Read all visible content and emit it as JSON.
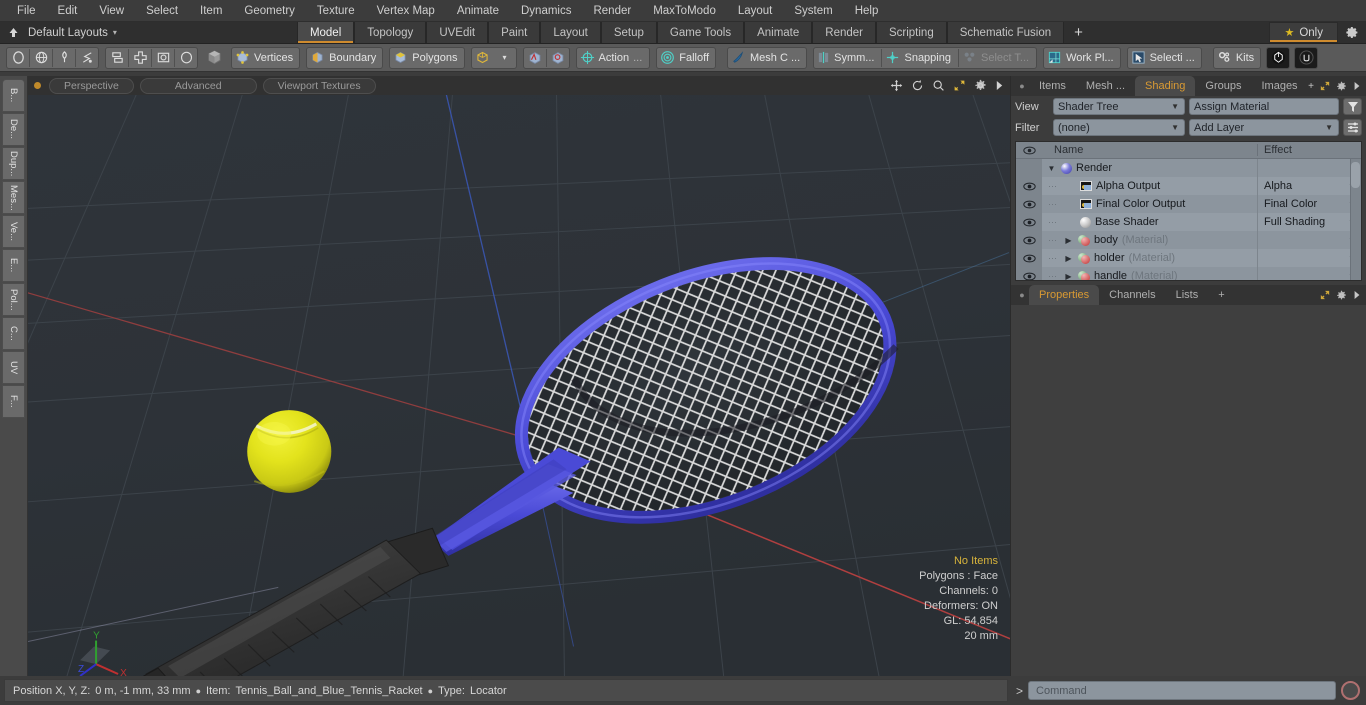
{
  "menubar": {
    "items": [
      "File",
      "Edit",
      "View",
      "Select",
      "Item",
      "Geometry",
      "Texture",
      "Vertex Map",
      "Animate",
      "Dynamics",
      "Render",
      "MaxToModo",
      "Layout",
      "System",
      "Help"
    ]
  },
  "layoutbar": {
    "layout_name": "Default Layouts",
    "caret": "▾",
    "tabs": [
      {
        "label": "Model",
        "active": true
      },
      {
        "label": "Topology",
        "active": false
      },
      {
        "label": "UVEdit",
        "active": false
      },
      {
        "label": "Paint",
        "active": false
      },
      {
        "label": "Layout",
        "active": false
      },
      {
        "label": "Setup",
        "active": false
      },
      {
        "label": "Game Tools",
        "active": false
      },
      {
        "label": "Animate",
        "active": false
      },
      {
        "label": "Render",
        "active": false
      },
      {
        "label": "Scripting",
        "active": false
      },
      {
        "label": "Schematic Fusion",
        "active": false
      }
    ],
    "add_tab": "+",
    "only_label": "Only",
    "star_glyph": "★",
    "gear_glyph": "⚙",
    "accent_color": "#cf8b2e"
  },
  "toolbar": {
    "selection_modes": [
      "circle-select-icon",
      "globe-select-icon",
      "lasso-paint-icon",
      "lasso-select-icon"
    ],
    "snap_modes": [
      "align-icon",
      "center-icon",
      "box-select-icon",
      "ellipse-select-icon"
    ],
    "component_mode_icon": "cube-icon",
    "vertices_label": "Vertices",
    "boundary_label": "Boundary",
    "polygons_label": "Polygons",
    "item_mode_icon": "cube-outline-icon",
    "item_caret": "▾",
    "action_label": "Action",
    "action_ellipsis": "...",
    "falloff_label": "Falloff",
    "mesh_constraint_label": "Mesh C ...",
    "symmetry_label": "Symm...",
    "snapping_label": "Snapping",
    "select_through_label": "Select T...",
    "work_plane_label": "Work Pl...",
    "selection_sets_label": "Selecti ...",
    "kits_label": "Kits",
    "preset_icon": "preset-browser-icon",
    "unreal_icon": "unreal-bridge-icon"
  },
  "left_strip": {
    "tabs": [
      "B...",
      "De...",
      "Dup...",
      "Mes...",
      "Ve...",
      "E...",
      "Pol...",
      "C...",
      "UV",
      "F..."
    ]
  },
  "viewport": {
    "header": {
      "view_mode": "Perspective",
      "shading_mode": "Advanced",
      "texture_mode": "Viewport Textures",
      "icons": [
        "pan-icon",
        "rotate-icon",
        "zoom-icon",
        "maximize-icon",
        "gear-icon",
        "play-arrow-icon"
      ]
    },
    "stats": {
      "no_items": "No Items",
      "polygons": "Polygons : Face",
      "channels": "Channels: 0",
      "deformers": "Deformers: ON",
      "gl": "GL: 54,854",
      "grid_size": "20 mm"
    },
    "axis_gizmo": {
      "x": "X",
      "y": "Y",
      "z": "Z",
      "x_color": "#c03030",
      "y_color": "#30a030",
      "z_color": "#3030c8"
    },
    "background_color": "#2e3338",
    "model": {
      "racket_frame_color": "#4a4ad6",
      "racket_string_color": "#e8e8e8",
      "handle_color": "#323232",
      "ball_color": "#e3e31c"
    }
  },
  "right_panel": {
    "tabs": [
      {
        "label": "Items",
        "active": false
      },
      {
        "label": "Mesh ...",
        "active": false
      },
      {
        "label": "Shading",
        "active": true
      },
      {
        "label": "Groups",
        "active": false
      },
      {
        "label": "Images",
        "active": false
      }
    ],
    "tab_icons": [
      "add-tab-icon",
      "expand-icon",
      "gear-icon",
      "chevron-right-icon"
    ],
    "view_label": "View",
    "view_value": "Shader Tree",
    "assign_material": "Assign Material",
    "filter_label": "Filter",
    "filter_value": "(none)",
    "add_layer": "Add Layer",
    "filter_icon": "funnel-icon",
    "list_icon": "list-options-icon",
    "tree": {
      "columns": {
        "eye": "eye-icon",
        "name": "Name",
        "effect": "Effect"
      },
      "rows": [
        {
          "eye": false,
          "indent": 0,
          "tri": "▼",
          "icon": "render-sphere-icon",
          "name": "Render",
          "suffix": "",
          "effect": ""
        },
        {
          "eye": true,
          "indent": 1,
          "tri": "",
          "icon": "image-output-icon",
          "name": "Alpha Output",
          "suffix": "",
          "effect": "Alpha"
        },
        {
          "eye": true,
          "indent": 1,
          "tri": "",
          "icon": "image-output-icon",
          "name": "Final Color Output",
          "suffix": "",
          "effect": "Final Color"
        },
        {
          "eye": true,
          "indent": 1,
          "tri": "",
          "icon": "base-shader-icon",
          "name": "Base Shader",
          "suffix": "",
          "effect": "Full Shading"
        },
        {
          "eye": true,
          "indent": 1,
          "tri": "▶",
          "icon": "material-icon",
          "name": "body",
          "suffix": "(Material)",
          "effect": ""
        },
        {
          "eye": true,
          "indent": 1,
          "tri": "▶",
          "icon": "material-icon",
          "name": "holder",
          "suffix": "(Material)",
          "effect": ""
        },
        {
          "eye": true,
          "indent": 1,
          "tri": "▶",
          "icon": "material-icon",
          "name": "handle",
          "suffix": "(Material)",
          "effect": ""
        }
      ]
    },
    "bottom_tabs": [
      {
        "label": "Properties",
        "active": true
      },
      {
        "label": "Channels",
        "active": false
      },
      {
        "label": "Lists",
        "active": false
      }
    ],
    "bottom_add": "+"
  },
  "statusbar": {
    "position_label": "Position X, Y, Z:",
    "position_value": "0 m, -1 mm, 33 mm",
    "item_label": "Item:",
    "item_value": "Tennis_Ball_and_Blue_Tennis_Racket",
    "type_label": "Type:",
    "type_value": "Locator",
    "bullet": "●",
    "prompt": ">",
    "command_placeholder": "Command"
  }
}
